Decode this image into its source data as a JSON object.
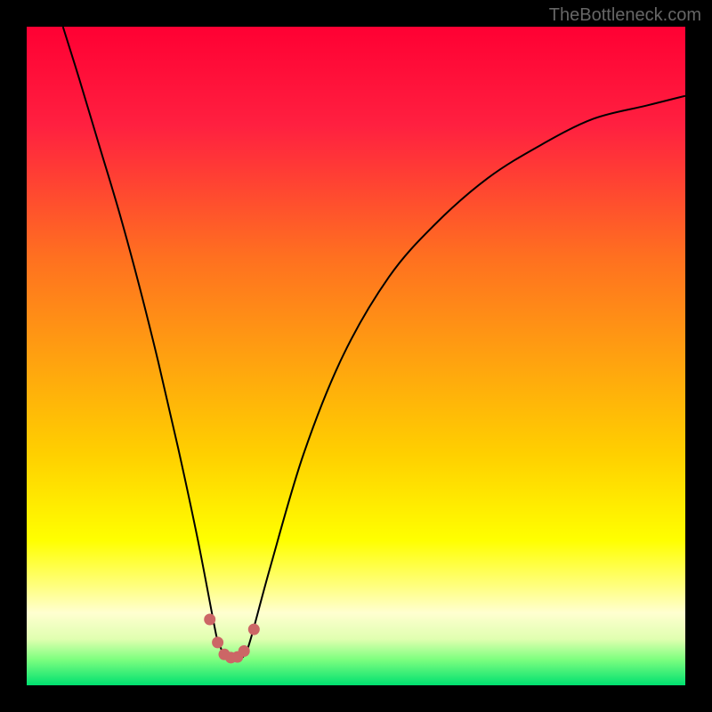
{
  "watermark": "TheBottleneck.com",
  "chart_data": {
    "type": "line",
    "title": "",
    "xlabel": "",
    "ylabel": "",
    "x": [
      0.055,
      0.08,
      0.11,
      0.14,
      0.17,
      0.2,
      0.23,
      0.26,
      0.285,
      0.29,
      0.3,
      0.31,
      0.32,
      0.33,
      0.34,
      0.37,
      0.42,
      0.48,
      0.55,
      0.62,
      0.7,
      0.78,
      0.86,
      0.94,
      1.0
    ],
    "values": [
      1.0,
      0.92,
      0.82,
      0.72,
      0.61,
      0.49,
      0.36,
      0.22,
      0.09,
      0.07,
      0.045,
      0.04,
      0.04,
      0.045,
      0.07,
      0.18,
      0.35,
      0.5,
      0.62,
      0.7,
      0.77,
      0.82,
      0.86,
      0.88,
      0.895
    ],
    "ylim": [
      0,
      1
    ],
    "xlim": [
      0,
      1
    ],
    "background_gradient": {
      "stops": [
        {
          "offset": 0,
          "color": "#ff0033"
        },
        {
          "offset": 0.15,
          "color": "#ff2040"
        },
        {
          "offset": 0.35,
          "color": "#ff7020"
        },
        {
          "offset": 0.5,
          "color": "#ffa010"
        },
        {
          "offset": 0.65,
          "color": "#ffd000"
        },
        {
          "offset": 0.78,
          "color": "#ffff00"
        },
        {
          "offset": 0.85,
          "color": "#ffff80"
        },
        {
          "offset": 0.89,
          "color": "#ffffd0"
        },
        {
          "offset": 0.93,
          "color": "#e0ffb0"
        },
        {
          "offset": 0.96,
          "color": "#80ff80"
        },
        {
          "offset": 1.0,
          "color": "#00e070"
        }
      ]
    },
    "highlight_dots": [
      {
        "x": 0.278,
        "y": 0.1
      },
      {
        "x": 0.29,
        "y": 0.065
      },
      {
        "x": 0.3,
        "y": 0.047
      },
      {
        "x": 0.31,
        "y": 0.042
      },
      {
        "x": 0.32,
        "y": 0.043
      },
      {
        "x": 0.33,
        "y": 0.052
      },
      {
        "x": 0.345,
        "y": 0.085
      }
    ],
    "dot_color": "#cc6666"
  }
}
